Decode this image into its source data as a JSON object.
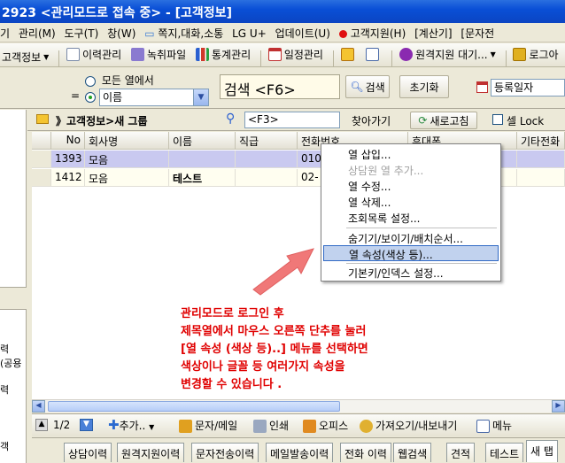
{
  "window": {
    "title": "2923 <관리모드로 접속 중> - [고객정보]"
  },
  "menubar": {
    "items": [
      "기",
      "관리(M)",
      "도구(T)",
      "창(W)",
      "쪽지,대화,소통",
      "LG U+",
      "업데이트(U)",
      "고객지원(H)",
      "[계산기]",
      "[문자전"
    ]
  },
  "toolbar": {
    "items": [
      "고객정보",
      "이력관리",
      "녹취파일",
      "통계관리",
      "일정관리",
      "",
      "",
      "원격지원 대기...",
      "로그아"
    ]
  },
  "search": {
    "radio_all": "모든 열에서",
    "eq": "=",
    "field_select": "이름",
    "search_input": "검색 <F6>",
    "search_button": "검색",
    "reset_button": "초기화",
    "date_select": "등록일자"
  },
  "breadcrumb": {
    "path": "》고객정보>새 그룹",
    "find_input": "<F3>",
    "goto_button": "찾아가기",
    "refresh_button": "새로고침",
    "cell_lock": "셀 Lock"
  },
  "grid": {
    "columns": [
      "No",
      "회사명",
      "이름",
      "직급",
      "전화번호",
      "휴대폰",
      "기타전화"
    ],
    "rows": [
      [
        "1393",
        "모음",
        "",
        "",
        "010",
        "",
        ""
      ],
      [
        "1412",
        "모음",
        "테스트",
        "",
        "02-",
        "",
        ""
      ]
    ]
  },
  "context_menu": {
    "items": [
      {
        "label": "열 삽입...",
        "state": "normal"
      },
      {
        "label": "상담원 열 추가...",
        "state": "disabled"
      },
      {
        "label": "열 수정...",
        "state": "normal"
      },
      {
        "label": "열 삭제...",
        "state": "normal"
      },
      {
        "label": "조회목록 설정...",
        "state": "normal"
      },
      {
        "label": "숨기기/보이기/배치순서...",
        "state": "normal"
      },
      {
        "label": "열 속성(색상 등)...",
        "state": "selected"
      },
      {
        "label": "기본키/인덱스 설정...",
        "state": "normal"
      }
    ]
  },
  "annotation": {
    "lines": [
      "관리모드로 로그인 후",
      "제목열에서 마우스 오른쪽 단추를 눌러",
      "[열 속성 (색상 등)..] 메뉴를 선택하면",
      "색상이나 글꼴 등 여러가지 속성을",
      "변경할 수 있습니다 ."
    ]
  },
  "left_panel": {
    "labels": [
      "력",
      "(공용",
      "력",
      "객"
    ]
  },
  "bottombar": {
    "page": "1/2",
    "add": "추가..",
    "sms": "문자/메일",
    "print": "인쇄",
    "office": "오피스",
    "import_export": "가져오기/내보내기",
    "menu": "메뉴"
  },
  "tabs": [
    "상담이력",
    "원격지원이력",
    "문자전송이력",
    "메일발송이력",
    "전화 이력",
    "웹검색",
    "견적",
    "테스트",
    "새 탭"
  ],
  "colors": {
    "titlebar": "#0b4fd6",
    "selected_row": "#c9c9f0",
    "menu_highlight": "#c1d2ee",
    "annotation": "#e00000",
    "arrow": "#f07878"
  }
}
